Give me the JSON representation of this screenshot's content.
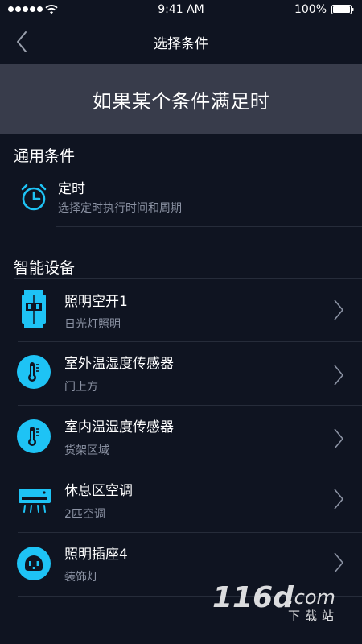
{
  "status": {
    "time": "9:41 AM",
    "battery": "100%"
  },
  "nav": {
    "title": "选择条件"
  },
  "banner": {
    "text": "如果某个条件满足时"
  },
  "general": {
    "header": "通用条件",
    "item": {
      "title": "定时",
      "subtitle": "选择定时执行时间和周期",
      "icon": "alarm-clock-icon"
    }
  },
  "devices": {
    "header": "智能设备",
    "items": [
      {
        "title": "照明空开1",
        "subtitle": "日光灯照明",
        "icon": "circuit-breaker-icon"
      },
      {
        "title": "室外温湿度传感器",
        "subtitle": "门上方",
        "icon": "thermometer-icon"
      },
      {
        "title": "室内温湿度传感器",
        "subtitle": "货架区域",
        "icon": "thermometer-icon"
      },
      {
        "title": "休息区空调",
        "subtitle": "2匹空调",
        "icon": "air-conditioner-icon"
      },
      {
        "title": "照明插座4",
        "subtitle": "装饰灯",
        "icon": "socket-icon"
      }
    ]
  },
  "watermark": {
    "brand": "116d.com",
    "caption": "下载站"
  },
  "colors": {
    "background": "#0f1421",
    "banner": "#383c4b",
    "accent": "#1ec3f5",
    "subtitle": "#8b92a3"
  }
}
